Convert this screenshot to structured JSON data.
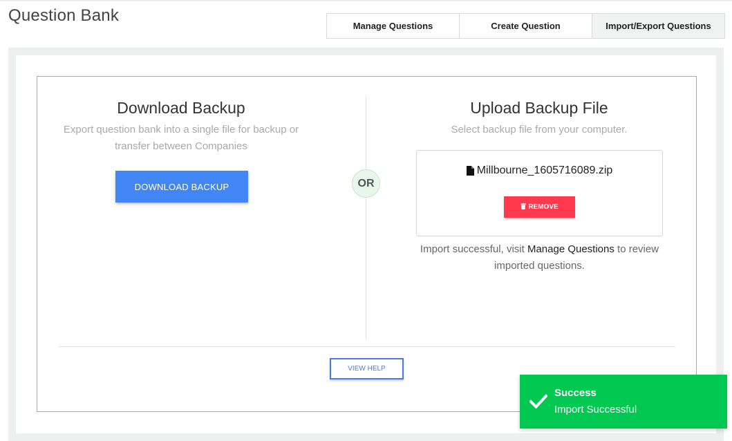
{
  "page": {
    "title": "Question Bank"
  },
  "tabs": [
    {
      "label": "Manage Questions"
    },
    {
      "label": "Create Question"
    },
    {
      "label": "Import/Export Questions"
    }
  ],
  "download": {
    "title": "Download Backup",
    "description": "Export question bank into a single file for backup or transfer between Companies",
    "button_label": "DOWNLOAD BACKUP"
  },
  "divider": {
    "or_label": "OR"
  },
  "upload": {
    "title": "Upload Backup File",
    "description": "Select backup file from your computer.",
    "file_name": "Millbourne_1605716089.zip",
    "file_icon": "file-icon",
    "remove_label": "REMOVE",
    "remove_icon": "trash-icon",
    "message_prefix": "Import successful, visit ",
    "message_link": "Manage Questions",
    "message_suffix": " to review imported questions."
  },
  "help": {
    "button_label": "VIEW HELP"
  },
  "toast": {
    "title": "Success",
    "message": "Import Successful",
    "icon": "check-icon"
  },
  "colors": {
    "primary_button": "#4285f4",
    "danger_button": "#ff3a4f",
    "success_toast": "#00c850",
    "help_button": "#4a7ce0"
  }
}
